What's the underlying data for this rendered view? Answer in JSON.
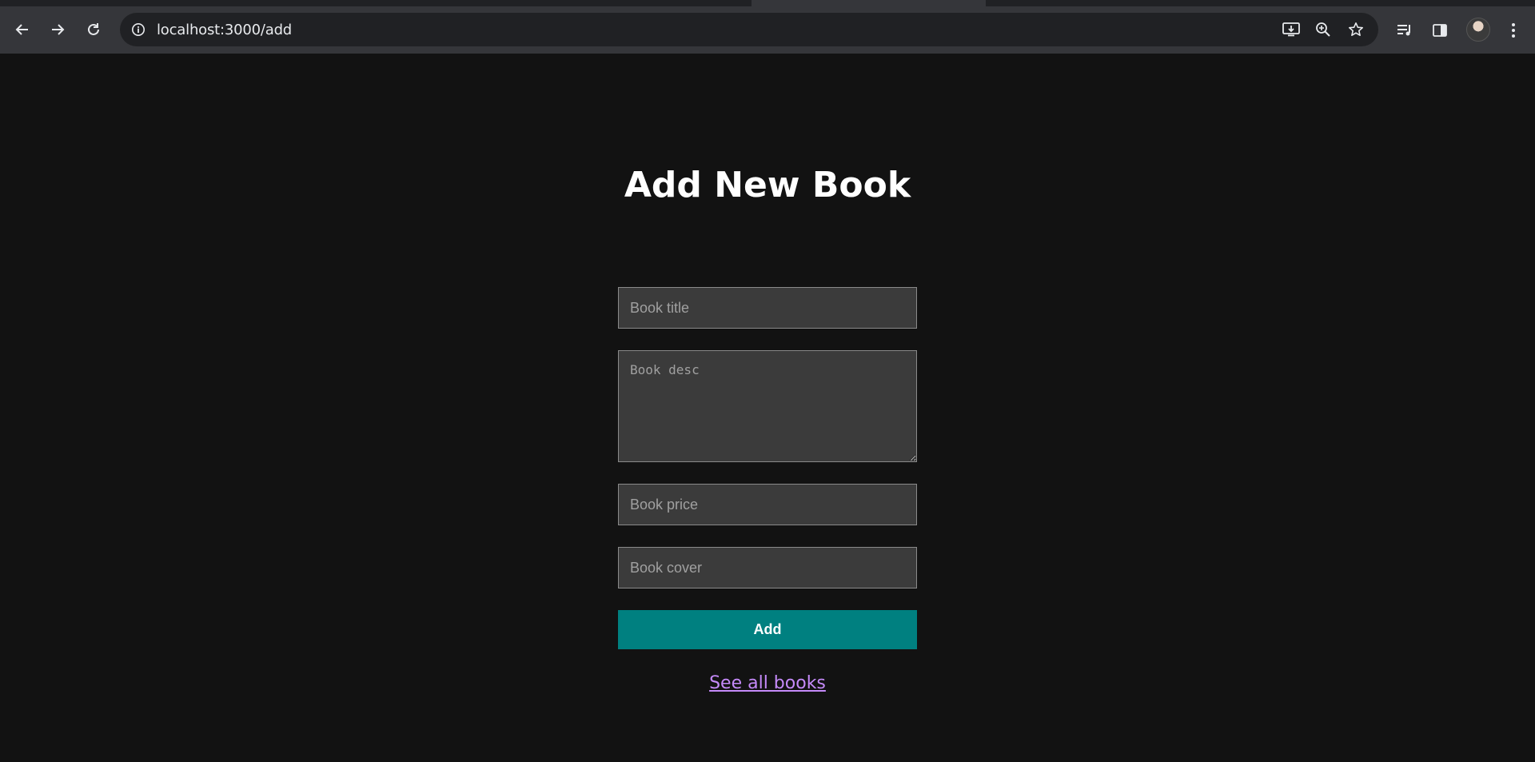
{
  "browser": {
    "url": "localhost:3000/add",
    "icons": {
      "back": "arrow-left-icon",
      "forward": "arrow-right-icon",
      "reload": "reload-icon",
      "site_info": "info-icon",
      "install": "install-app-icon",
      "zoom": "zoom-icon",
      "bookmark": "star-icon",
      "media": "media-queue-icon",
      "side_panel": "side-panel-icon",
      "menu": "kebab-menu-icon"
    }
  },
  "page": {
    "title": "Add New Book",
    "form": {
      "title_placeholder": "Book title",
      "desc_placeholder": "Book desc",
      "price_placeholder": "Book price",
      "cover_placeholder": "Book cover",
      "submit_label": "Add"
    },
    "link_label": "See all books"
  },
  "colors": {
    "background": "#121212",
    "button": "#008080",
    "link": "#c58af9",
    "field_background": "#3b3b3b"
  }
}
